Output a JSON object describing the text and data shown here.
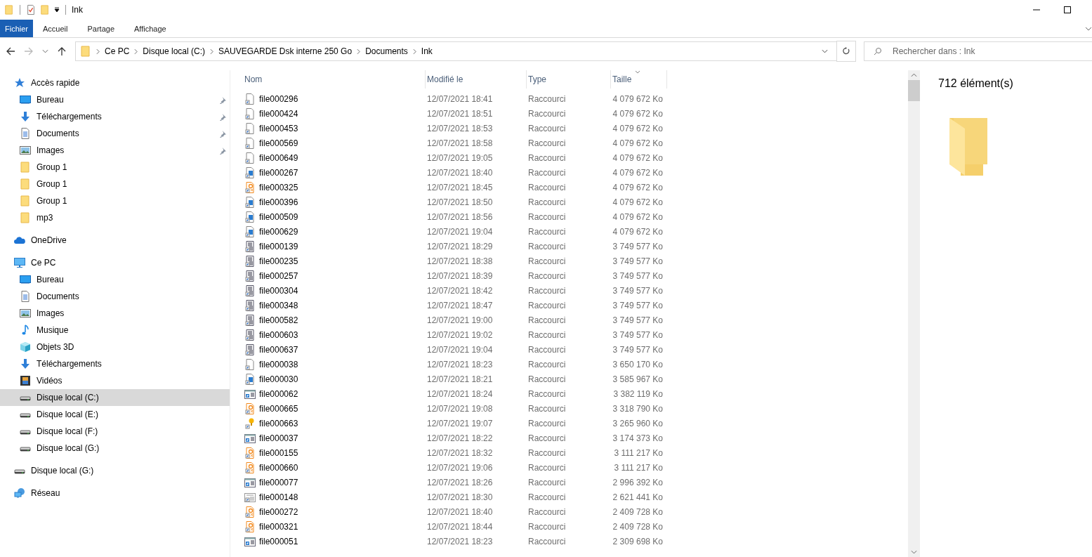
{
  "window": {
    "title": "Ink"
  },
  "ribbon_tabs": [
    {
      "label": "Fichier",
      "selected": true
    },
    {
      "label": "Accueil",
      "selected": false
    },
    {
      "label": "Partage",
      "selected": false
    },
    {
      "label": "Affichage",
      "selected": false
    }
  ],
  "address_bar": {
    "breadcrumbs": [
      "Ce PC",
      "Disque local (C:)",
      "SAUVEGARDE Dsk interne 250 Go",
      "Documents",
      "Ink"
    ]
  },
  "search": {
    "placeholder": "Rechercher dans : Ink"
  },
  "sidebar": {
    "items": [
      {
        "label": "Accès rapide",
        "kind": "star",
        "selected": false,
        "children": [
          {
            "label": "Bureau",
            "kind": "desktop",
            "selected": false,
            "pinned": true
          },
          {
            "label": "Téléchargements",
            "kind": "download",
            "selected": false,
            "pinned": true
          },
          {
            "label": "Documents",
            "kind": "document",
            "selected": false,
            "pinned": true
          },
          {
            "label": "Images",
            "kind": "picture",
            "selected": false,
            "pinned": true
          },
          {
            "label": "Group 1",
            "kind": "folder",
            "selected": false,
            "pinned": false
          },
          {
            "label": "Group 1",
            "kind": "folder",
            "selected": false,
            "pinned": false
          },
          {
            "label": "Group 1",
            "kind": "folder",
            "selected": false,
            "pinned": false
          },
          {
            "label": "mp3",
            "kind": "folder",
            "selected": false,
            "pinned": false
          }
        ]
      },
      {
        "label": "OneDrive",
        "kind": "cloud",
        "selected": false
      },
      {
        "label": "Ce PC",
        "kind": "computer",
        "selected": false,
        "children": [
          {
            "label": "Bureau",
            "kind": "desktop",
            "selected": false
          },
          {
            "label": "Documents",
            "kind": "document",
            "selected": false
          },
          {
            "label": "Images",
            "kind": "picture",
            "selected": false
          },
          {
            "label": "Musique",
            "kind": "music",
            "selected": false
          },
          {
            "label": "Objets 3D",
            "kind": "cube",
            "selected": false
          },
          {
            "label": "Téléchargements",
            "kind": "download",
            "selected": false
          },
          {
            "label": "Vidéos",
            "kind": "film",
            "selected": false
          },
          {
            "label": "Disque local (C:)",
            "kind": "drive",
            "selected": true
          },
          {
            "label": "Disque local (E:)",
            "kind": "drive",
            "selected": false
          },
          {
            "label": "Disque local (F:)",
            "kind": "drive",
            "selected": false
          },
          {
            "label": "Disque local (G:)",
            "kind": "drive",
            "selected": false
          }
        ]
      },
      {
        "label": "Disque local (G:)",
        "kind": "drive",
        "selected": false
      },
      {
        "label": "Réseau",
        "kind": "network",
        "selected": false
      }
    ]
  },
  "table": {
    "columns": [
      {
        "label": "Nom",
        "sorted": false
      },
      {
        "label": "Modifié le",
        "sorted": false
      },
      {
        "label": "Type",
        "sorted": false
      },
      {
        "label": "Taille",
        "sorted": true
      }
    ],
    "rows": [
      {
        "name": "file000296",
        "modified": "12/07/2021 18:41",
        "type": "Raccourci",
        "size": "4 079 672 Ko",
        "kind": "plain"
      },
      {
        "name": "file000424",
        "modified": "12/07/2021 18:51",
        "type": "Raccourci",
        "size": "4 079 672 Ko",
        "kind": "plain"
      },
      {
        "name": "file000453",
        "modified": "12/07/2021 18:53",
        "type": "Raccourci",
        "size": "4 079 672 Ko",
        "kind": "plain"
      },
      {
        "name": "file000569",
        "modified": "12/07/2021 18:58",
        "type": "Raccourci",
        "size": "4 079 672 Ko",
        "kind": "plain"
      },
      {
        "name": "file000649",
        "modified": "12/07/2021 19:05",
        "type": "Raccourci",
        "size": "4 079 672 Ko",
        "kind": "plain"
      },
      {
        "name": "file000267",
        "modified": "12/07/2021 18:40",
        "type": "Raccourci",
        "size": "4 079 672 Ko",
        "kind": "media"
      },
      {
        "name": "file000325",
        "modified": "12/07/2021 18:45",
        "type": "Raccourci",
        "size": "4 079 672 Ko",
        "kind": "orange"
      },
      {
        "name": "file000396",
        "modified": "12/07/2021 18:50",
        "type": "Raccourci",
        "size": "4 079 672 Ko",
        "kind": "media"
      },
      {
        "name": "file000509",
        "modified": "12/07/2021 18:56",
        "type": "Raccourci",
        "size": "4 079 672 Ko",
        "kind": "media"
      },
      {
        "name": "file000629",
        "modified": "12/07/2021 19:04",
        "type": "Raccourci",
        "size": "4 079 672 Ko",
        "kind": "media"
      },
      {
        "name": "file000139",
        "modified": "12/07/2021 18:29",
        "type": "Raccourci",
        "size": "3 749 577 Ko",
        "kind": "stack"
      },
      {
        "name": "file000235",
        "modified": "12/07/2021 18:38",
        "type": "Raccourci",
        "size": "3 749 577 Ko",
        "kind": "stack"
      },
      {
        "name": "file000257",
        "modified": "12/07/2021 18:39",
        "type": "Raccourci",
        "size": "3 749 577 Ko",
        "kind": "stack"
      },
      {
        "name": "file000304",
        "modified": "12/07/2021 18:42",
        "type": "Raccourci",
        "size": "3 749 577 Ko",
        "kind": "stack"
      },
      {
        "name": "file000348",
        "modified": "12/07/2021 18:47",
        "type": "Raccourci",
        "size": "3 749 577 Ko",
        "kind": "stack"
      },
      {
        "name": "file000582",
        "modified": "12/07/2021 19:00",
        "type": "Raccourci",
        "size": "3 749 577 Ko",
        "kind": "stack"
      },
      {
        "name": "file000603",
        "modified": "12/07/2021 19:02",
        "type": "Raccourci",
        "size": "3 749 577 Ko",
        "kind": "stack"
      },
      {
        "name": "file000637",
        "modified": "12/07/2021 19:04",
        "type": "Raccourci",
        "size": "3 749 577 Ko",
        "kind": "stack"
      },
      {
        "name": "file000038",
        "modified": "12/07/2021 18:23",
        "type": "Raccourci",
        "size": "3 650 170 Ko",
        "kind": "plain"
      },
      {
        "name": "file000030",
        "modified": "12/07/2021 18:21",
        "type": "Raccourci",
        "size": "3 585 967 Ko",
        "kind": "media"
      },
      {
        "name": "file000062",
        "modified": "12/07/2021 18:24",
        "type": "Raccourci",
        "size": "3 382 119 Ko",
        "kind": "window"
      },
      {
        "name": "file000665",
        "modified": "12/07/2021 19:08",
        "type": "Raccourci",
        "size": "3 318 790 Ko",
        "kind": "orange"
      },
      {
        "name": "file000663",
        "modified": "12/07/2021 19:07",
        "type": "Raccourci",
        "size": "3 265 960 Ko",
        "kind": "bulb"
      },
      {
        "name": "file000037",
        "modified": "12/07/2021 18:22",
        "type": "Raccourci",
        "size": "3 174 373 Ko",
        "kind": "window"
      },
      {
        "name": "file000155",
        "modified": "12/07/2021 18:32",
        "type": "Raccourci",
        "size": "3 111 217 Ko",
        "kind": "orange"
      },
      {
        "name": "file000660",
        "modified": "12/07/2021 19:06",
        "type": "Raccourci",
        "size": "3 111 217 Ko",
        "kind": "orange"
      },
      {
        "name": "file000077",
        "modified": "12/07/2021 18:26",
        "type": "Raccourci",
        "size": "2 996 392 Ko",
        "kind": "window"
      },
      {
        "name": "file000148",
        "modified": "12/07/2021 18:30",
        "type": "Raccourci",
        "size": "2 621 441 Ko",
        "kind": "form"
      },
      {
        "name": "file000272",
        "modified": "12/07/2021 18:40",
        "type": "Raccourci",
        "size": "2 409 728 Ko",
        "kind": "orange"
      },
      {
        "name": "file000321",
        "modified": "12/07/2021 18:44",
        "type": "Raccourci",
        "size": "2 409 728 Ko",
        "kind": "orange"
      },
      {
        "name": "file000051",
        "modified": "12/07/2021 18:23",
        "type": "Raccourci",
        "size": "2 309 698 Ko",
        "kind": "window"
      }
    ]
  },
  "details_pane": {
    "count": "712 élément(s)"
  }
}
